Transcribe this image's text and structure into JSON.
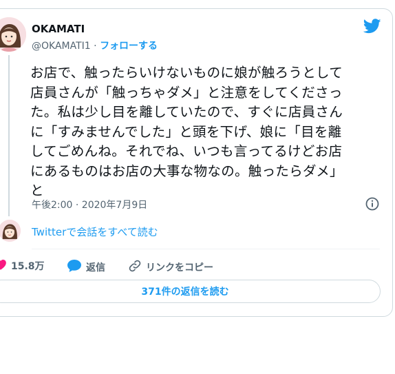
{
  "author": {
    "name": "OKAMATI",
    "handle": "@OKAMATI1",
    "separator": " · ",
    "follow_label": "フォローする"
  },
  "tweet": {
    "text": "お店で、触ったらいけないものに娘が触ろうとして\n店員さんが「触っちゃダメ」と注意をしてくださっ\nた。私は少し目を離していたので、すぐに店員さん\nに「すみませんでした」と頭を下げ、娘に「目を離\nしてごめんね。それでね、いつも言ってるけどお店\nにあるものはお店の大事な物なの。触ったらダメ」\nと",
    "timestamp": "午後2:00 · 2020年7月9日"
  },
  "conversation": {
    "label": "Twitterで会話をすべて読む"
  },
  "actions": {
    "like_count": "15.8万",
    "reply_label": "返信",
    "copy_link_label": "リンクをコピー"
  },
  "replies_button": {
    "label": "371件の返信を読む"
  },
  "colors": {
    "accent": "#1d9bf0",
    "like": "#f91880",
    "text": "#0f1419",
    "muted": "#536471"
  },
  "icons": [
    "twitter-bird-icon",
    "info-icon",
    "heart-icon",
    "reply-bubble-icon",
    "link-icon"
  ]
}
